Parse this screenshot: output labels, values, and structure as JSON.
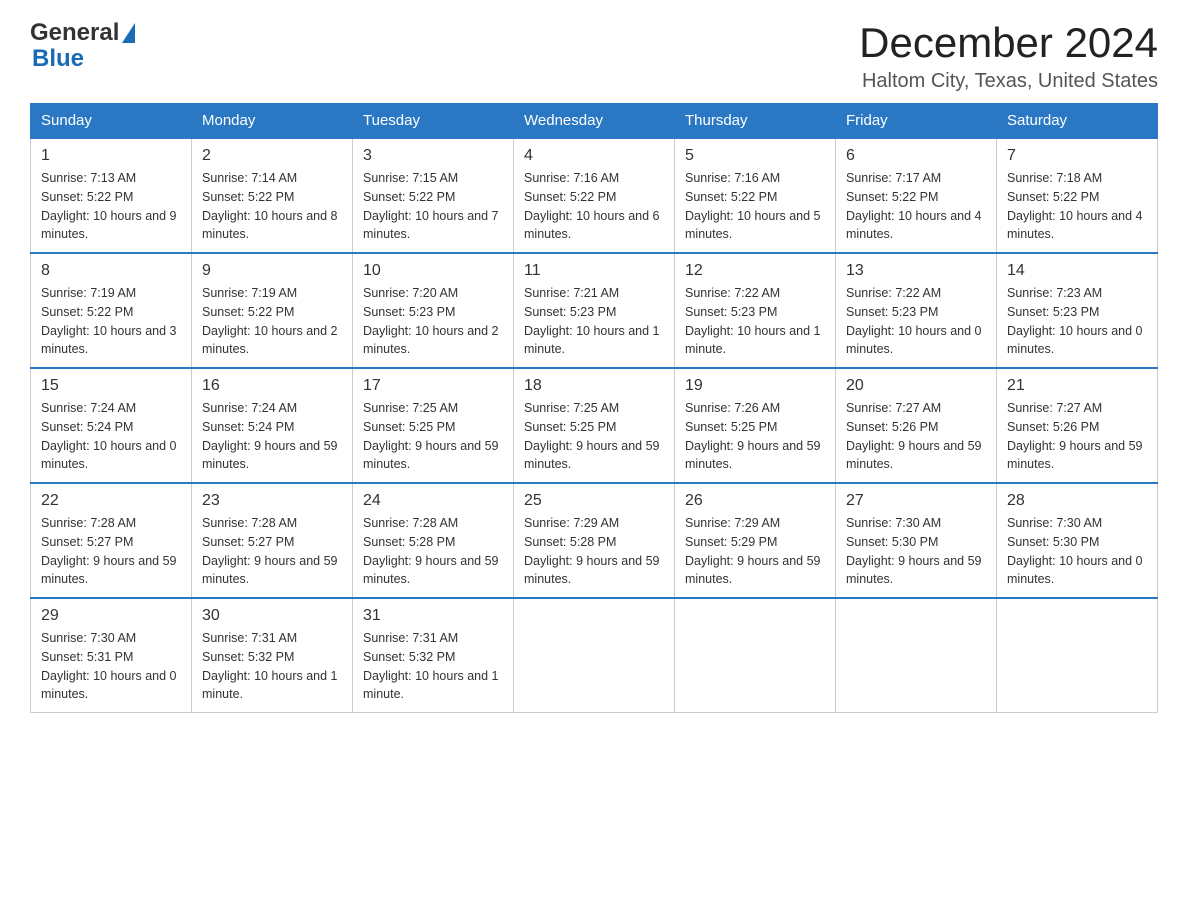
{
  "header": {
    "logo_general": "General",
    "logo_blue": "Blue",
    "month_title": "December 2024",
    "subtitle": "Haltom City, Texas, United States"
  },
  "days_of_week": [
    "Sunday",
    "Monday",
    "Tuesday",
    "Wednesday",
    "Thursday",
    "Friday",
    "Saturday"
  ],
  "weeks": [
    [
      {
        "day": "1",
        "sunrise": "7:13 AM",
        "sunset": "5:22 PM",
        "daylight": "10 hours and 9 minutes."
      },
      {
        "day": "2",
        "sunrise": "7:14 AM",
        "sunset": "5:22 PM",
        "daylight": "10 hours and 8 minutes."
      },
      {
        "day": "3",
        "sunrise": "7:15 AM",
        "sunset": "5:22 PM",
        "daylight": "10 hours and 7 minutes."
      },
      {
        "day": "4",
        "sunrise": "7:16 AM",
        "sunset": "5:22 PM",
        "daylight": "10 hours and 6 minutes."
      },
      {
        "day": "5",
        "sunrise": "7:16 AM",
        "sunset": "5:22 PM",
        "daylight": "10 hours and 5 minutes."
      },
      {
        "day": "6",
        "sunrise": "7:17 AM",
        "sunset": "5:22 PM",
        "daylight": "10 hours and 4 minutes."
      },
      {
        "day": "7",
        "sunrise": "7:18 AM",
        "sunset": "5:22 PM",
        "daylight": "10 hours and 4 minutes."
      }
    ],
    [
      {
        "day": "8",
        "sunrise": "7:19 AM",
        "sunset": "5:22 PM",
        "daylight": "10 hours and 3 minutes."
      },
      {
        "day": "9",
        "sunrise": "7:19 AM",
        "sunset": "5:22 PM",
        "daylight": "10 hours and 2 minutes."
      },
      {
        "day": "10",
        "sunrise": "7:20 AM",
        "sunset": "5:23 PM",
        "daylight": "10 hours and 2 minutes."
      },
      {
        "day": "11",
        "sunrise": "7:21 AM",
        "sunset": "5:23 PM",
        "daylight": "10 hours and 1 minute."
      },
      {
        "day": "12",
        "sunrise": "7:22 AM",
        "sunset": "5:23 PM",
        "daylight": "10 hours and 1 minute."
      },
      {
        "day": "13",
        "sunrise": "7:22 AM",
        "sunset": "5:23 PM",
        "daylight": "10 hours and 0 minutes."
      },
      {
        "day": "14",
        "sunrise": "7:23 AM",
        "sunset": "5:23 PM",
        "daylight": "10 hours and 0 minutes."
      }
    ],
    [
      {
        "day": "15",
        "sunrise": "7:24 AM",
        "sunset": "5:24 PM",
        "daylight": "10 hours and 0 minutes."
      },
      {
        "day": "16",
        "sunrise": "7:24 AM",
        "sunset": "5:24 PM",
        "daylight": "9 hours and 59 minutes."
      },
      {
        "day": "17",
        "sunrise": "7:25 AM",
        "sunset": "5:25 PM",
        "daylight": "9 hours and 59 minutes."
      },
      {
        "day": "18",
        "sunrise": "7:25 AM",
        "sunset": "5:25 PM",
        "daylight": "9 hours and 59 minutes."
      },
      {
        "day": "19",
        "sunrise": "7:26 AM",
        "sunset": "5:25 PM",
        "daylight": "9 hours and 59 minutes."
      },
      {
        "day": "20",
        "sunrise": "7:27 AM",
        "sunset": "5:26 PM",
        "daylight": "9 hours and 59 minutes."
      },
      {
        "day": "21",
        "sunrise": "7:27 AM",
        "sunset": "5:26 PM",
        "daylight": "9 hours and 59 minutes."
      }
    ],
    [
      {
        "day": "22",
        "sunrise": "7:28 AM",
        "sunset": "5:27 PM",
        "daylight": "9 hours and 59 minutes."
      },
      {
        "day": "23",
        "sunrise": "7:28 AM",
        "sunset": "5:27 PM",
        "daylight": "9 hours and 59 minutes."
      },
      {
        "day": "24",
        "sunrise": "7:28 AM",
        "sunset": "5:28 PM",
        "daylight": "9 hours and 59 minutes."
      },
      {
        "day": "25",
        "sunrise": "7:29 AM",
        "sunset": "5:28 PM",
        "daylight": "9 hours and 59 minutes."
      },
      {
        "day": "26",
        "sunrise": "7:29 AM",
        "sunset": "5:29 PM",
        "daylight": "9 hours and 59 minutes."
      },
      {
        "day": "27",
        "sunrise": "7:30 AM",
        "sunset": "5:30 PM",
        "daylight": "9 hours and 59 minutes."
      },
      {
        "day": "28",
        "sunrise": "7:30 AM",
        "sunset": "5:30 PM",
        "daylight": "10 hours and 0 minutes."
      }
    ],
    [
      {
        "day": "29",
        "sunrise": "7:30 AM",
        "sunset": "5:31 PM",
        "daylight": "10 hours and 0 minutes."
      },
      {
        "day": "30",
        "sunrise": "7:31 AM",
        "sunset": "5:32 PM",
        "daylight": "10 hours and 1 minute."
      },
      {
        "day": "31",
        "sunrise": "7:31 AM",
        "sunset": "5:32 PM",
        "daylight": "10 hours and 1 minute."
      },
      null,
      null,
      null,
      null
    ]
  ],
  "labels": {
    "sunrise": "Sunrise:",
    "sunset": "Sunset:",
    "daylight": "Daylight:"
  },
  "colors": {
    "header_bg": "#2a78c4",
    "border": "#2a78c4"
  }
}
